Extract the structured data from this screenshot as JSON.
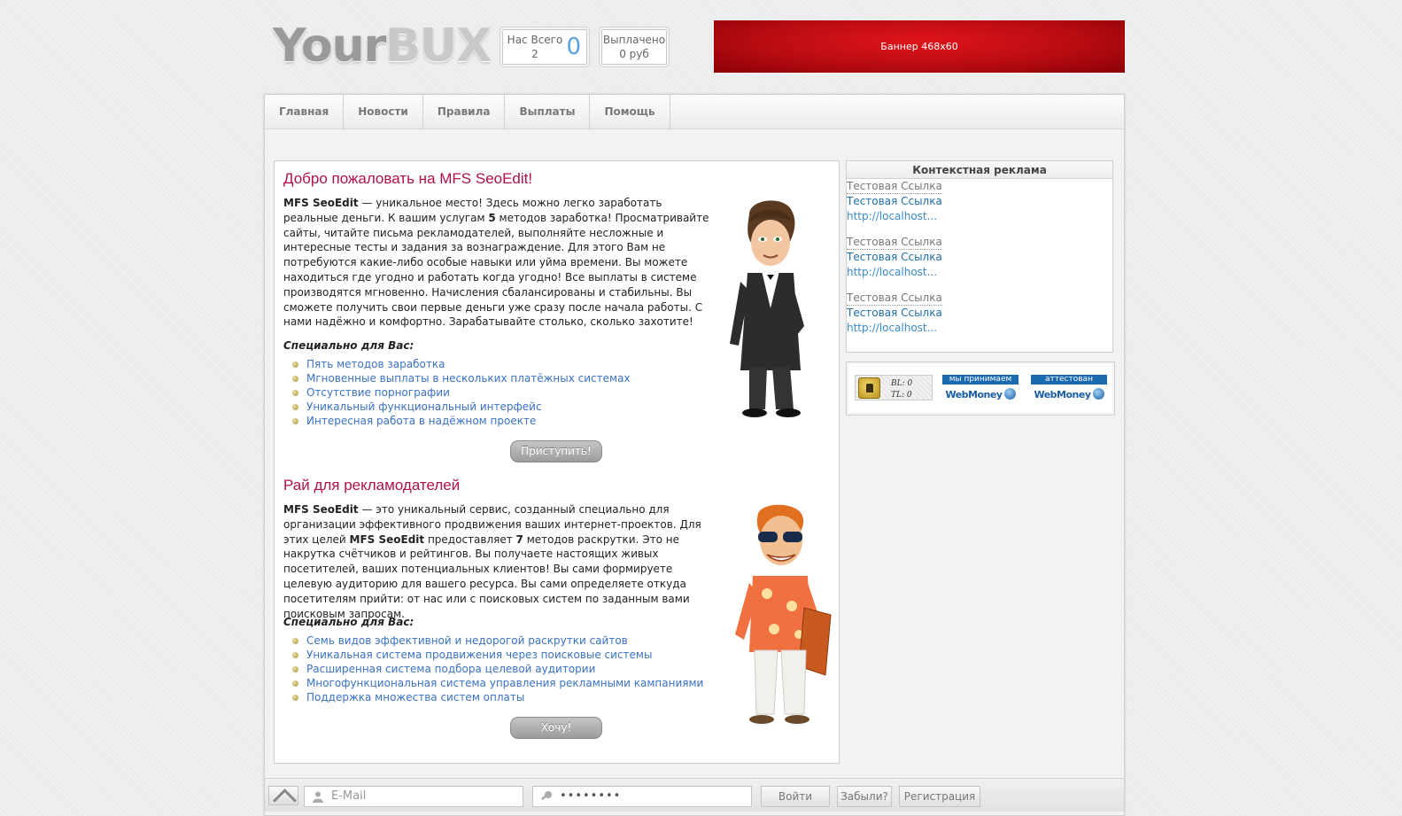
{
  "header": {
    "logo_your": "Your",
    "logo_bux": "BUX",
    "stat_total_label": "Нас Всего",
    "stat_total_value": "2",
    "stat_online": "0",
    "stat_paid_label": "Выплачено",
    "stat_paid_value": "0 руб",
    "banner_text": "Баннер 468x60"
  },
  "nav": {
    "items": [
      {
        "label": "Главная"
      },
      {
        "label": "Новости"
      },
      {
        "label": "Правила"
      },
      {
        "label": "Выплаты"
      },
      {
        "label": "Помощь"
      }
    ]
  },
  "section1": {
    "title": "Добро пожаловать на MFS SeoEdit!",
    "brand": "MFS SeoEdit",
    "text_a": " — уникальное место! Здесь можно легко заработать реальные деньги. К вашим услугам ",
    "count": "5",
    "text_b": " методов заработка! Просматривайте сайты, читайте письма рекламодателей, выполняйте несложные и интересные тесты и задания за вознаграждение. Для этого Вам не потребуются какие-либо особые навыки или уйма времени. Вы можете находиться где угодно и работать когда угодно! Все выплаты в системе производятся мгновенно. Начисления сбалансированы и стабильны. Вы сможете получить свои первые деньги уже сразу после начала работы. С нами надёжно и комфортно. Зарабатывайте столько, сколько захотите!",
    "subtitle": "Специально для Вас:",
    "features": [
      "Пять методов заработка",
      "Мгновенные выплаты в нескольких платёжных системах",
      "Отсутствие порнографии",
      "Уникальный функциональный интерфейс",
      "Интересная работа в надёжном проекте"
    ],
    "button": "Приступить!"
  },
  "section2": {
    "title": "Рай для рекламодателей",
    "brand": "MFS SeoEdit",
    "text_a": " — это уникальный сервис, созданный специально для организации эффективного продвижения ваших интернет-проектов. Для этих целей ",
    "brand2": "MFS SeoEdit",
    "text_b": " предоставляет ",
    "count": "7",
    "text_c": " методов раскрутки. Это не накрутка счётчиков и рейтингов. Вы получаете настоящих живых посетителей, ваших потенциальных клиентов! Вы сами формируете целевую аудиторию для вашего ресурса. Вы сами определяете откуда посетителям прийти: от нас или с поисковых систем по заданным вами поисковым запросам.",
    "subtitle": "Специально для Вас:",
    "features": [
      "Семь видов эффективной и недорогой раскрутки сайтов",
      "Уникальная система продвижения через поисковые системы",
      "Расширенная система подбора целевой аудитории",
      "Многофункциональная система управления рекламными кампаниями",
      "Поддержка множества систем оплаты"
    ],
    "button": "Хочу!"
  },
  "sidebar": {
    "ad_title": "Контекстная реклама",
    "ads": [
      {
        "title": "Тестовая Ссылка",
        "desc": "Тестовая Ссылка",
        "url": "http://localhost..."
      },
      {
        "title": "Тестовая Ссылка",
        "desc": "Тестовая Ссылка",
        "url": "http://localhost..."
      },
      {
        "title": "Тестовая Ссылка",
        "desc": "Тестовая Ссылка",
        "url": "http://localhost..."
      }
    ],
    "bl_label": "BL: 0",
    "tl_label": "TL: 0",
    "wm_accept_top": "мы принимаем",
    "wm_accept_logo": "WebMoney",
    "wm_attest_top": "аттестован",
    "wm_attest_logo": "WebMoney"
  },
  "login": {
    "email_placeholder": "E-Mail",
    "password_value": "••••••••",
    "login_button": "Войти",
    "forgot_button": "Забыли?",
    "register_button": "Регистрация"
  },
  "colors": {
    "accent_title": "#b0104a",
    "link": "#3a72c4",
    "banner": "#b80c12"
  }
}
